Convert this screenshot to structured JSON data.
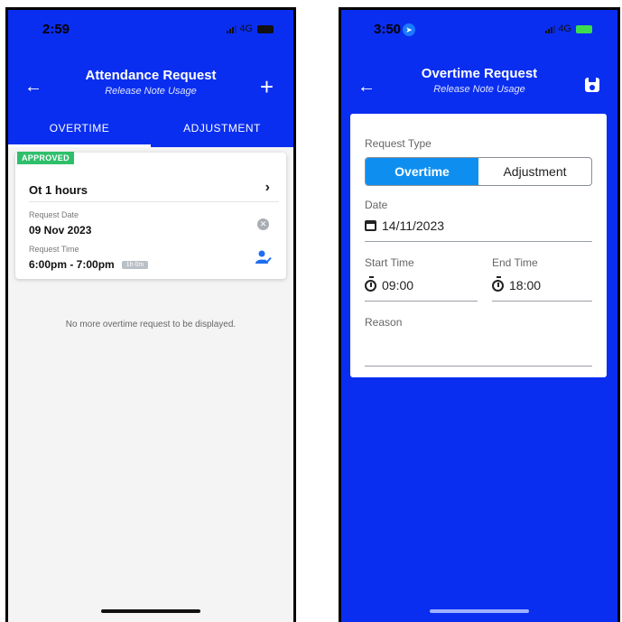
{
  "left": {
    "status": {
      "time": "2:59",
      "network": "4G"
    },
    "header": {
      "title": "Attendance Request",
      "subtitle": "Release Note Usage"
    },
    "tabs": [
      {
        "label": "OVERTIME",
        "active": true
      },
      {
        "label": "ADJUSTMENT",
        "active": false
      }
    ],
    "card": {
      "status_badge": "APPROVED",
      "title": "Ot 1 hours",
      "request_date_label": "Request Date",
      "request_date": "09 Nov 2023",
      "request_time_label": "Request Time",
      "request_time": "6:00pm - 7:00pm",
      "duration": "1h 0m"
    },
    "empty_message": "No more overtime request to be displayed."
  },
  "right": {
    "status": {
      "time": "3:50",
      "network": "4G"
    },
    "header": {
      "title": "Overtime Request",
      "subtitle": "Release Note Usage"
    },
    "form": {
      "request_type_label": "Request Type",
      "segments": [
        "Overtime",
        "Adjustment"
      ],
      "selected_segment": "Overtime",
      "date_label": "Date",
      "date_value": "14/11/2023",
      "start_time_label": "Start Time",
      "start_time_value": "09:00",
      "end_time_label": "End Time",
      "end_time_value": "18:00",
      "reason_label": "Reason",
      "reason_value": ""
    }
  },
  "colors": {
    "brand_blue": "#0a2ef0",
    "segment_active": "#0e8ff0",
    "approved_green": "#2fbf6b"
  },
  "icons": [
    "back-arrow-icon",
    "plus-icon",
    "chevron-right-icon",
    "cancel-icon",
    "person-check-icon",
    "save-icon",
    "calendar-icon",
    "timer-icon"
  ]
}
